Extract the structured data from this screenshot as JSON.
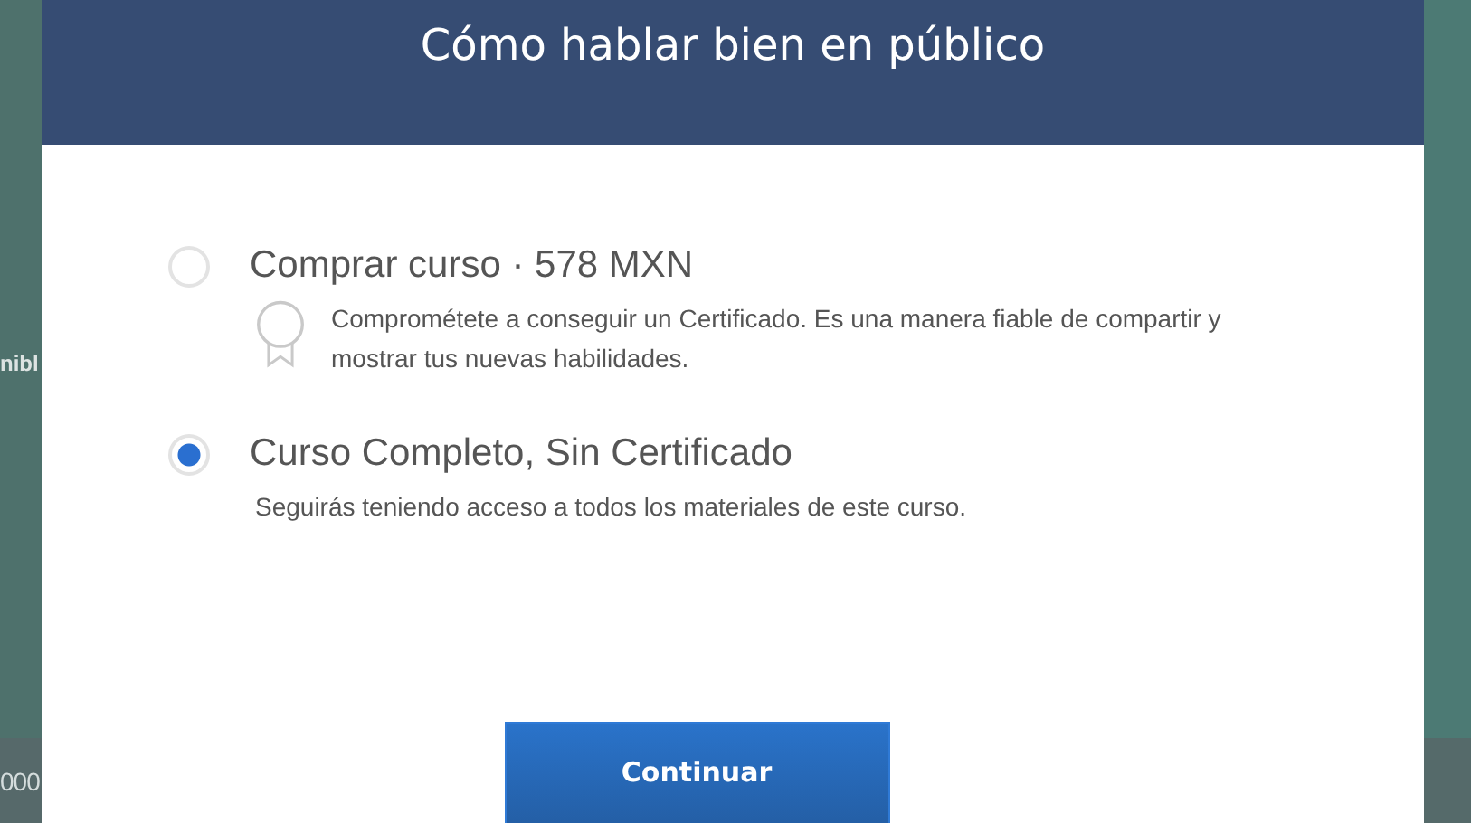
{
  "background": {
    "left_texts": [
      "nibl",
      "000"
    ]
  },
  "dialog": {
    "title": "Cómo hablar bien en público",
    "options": [
      {
        "label": "Comprar curso · 578 MXN",
        "selected": false,
        "kind": "certificate",
        "description": "Comprométete a conseguir un Certificado. Es una manera fiable de compartir y mostrar tus nuevas habilidades."
      },
      {
        "label": "Curso Completo, Sin Certificado",
        "selected": true,
        "kind": "plain",
        "description": "Seguirás teniendo acceso a todos los materiales de este curso."
      }
    ],
    "button": "Continuar"
  }
}
